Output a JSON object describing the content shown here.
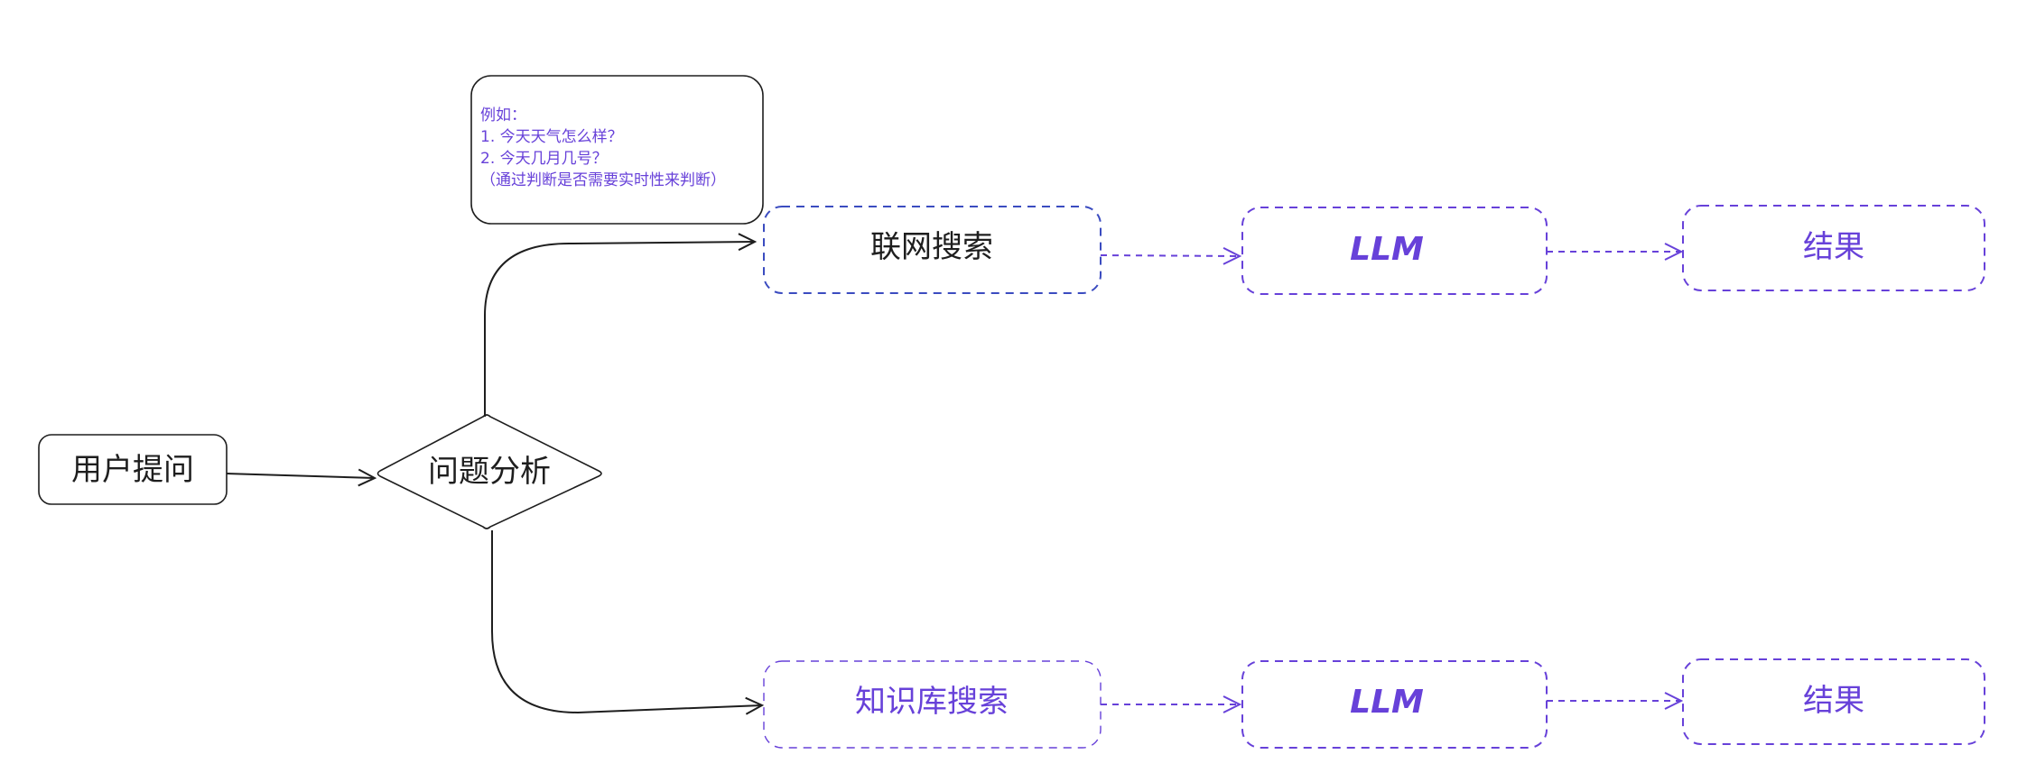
{
  "nodes": {
    "user_question": "用户提问",
    "problem_analysis": "问题分析",
    "web_search": "联网搜索",
    "knowledge_search": "知识库搜索",
    "llm_top": "LLM",
    "llm_bottom": "LLM",
    "result_top": "结果",
    "result_bottom": "结果"
  },
  "note": {
    "lines": [
      "例如：",
      "1. 今天天气怎么样？",
      "2. 今天几月几号？",
      "（通过判断是否需要实时性来判断）"
    ]
  },
  "colors": {
    "stroke": "#1e1e1e",
    "accent": "#6741d9",
    "dashed_blue": "#3b4cc0",
    "background": "#ffffff"
  }
}
